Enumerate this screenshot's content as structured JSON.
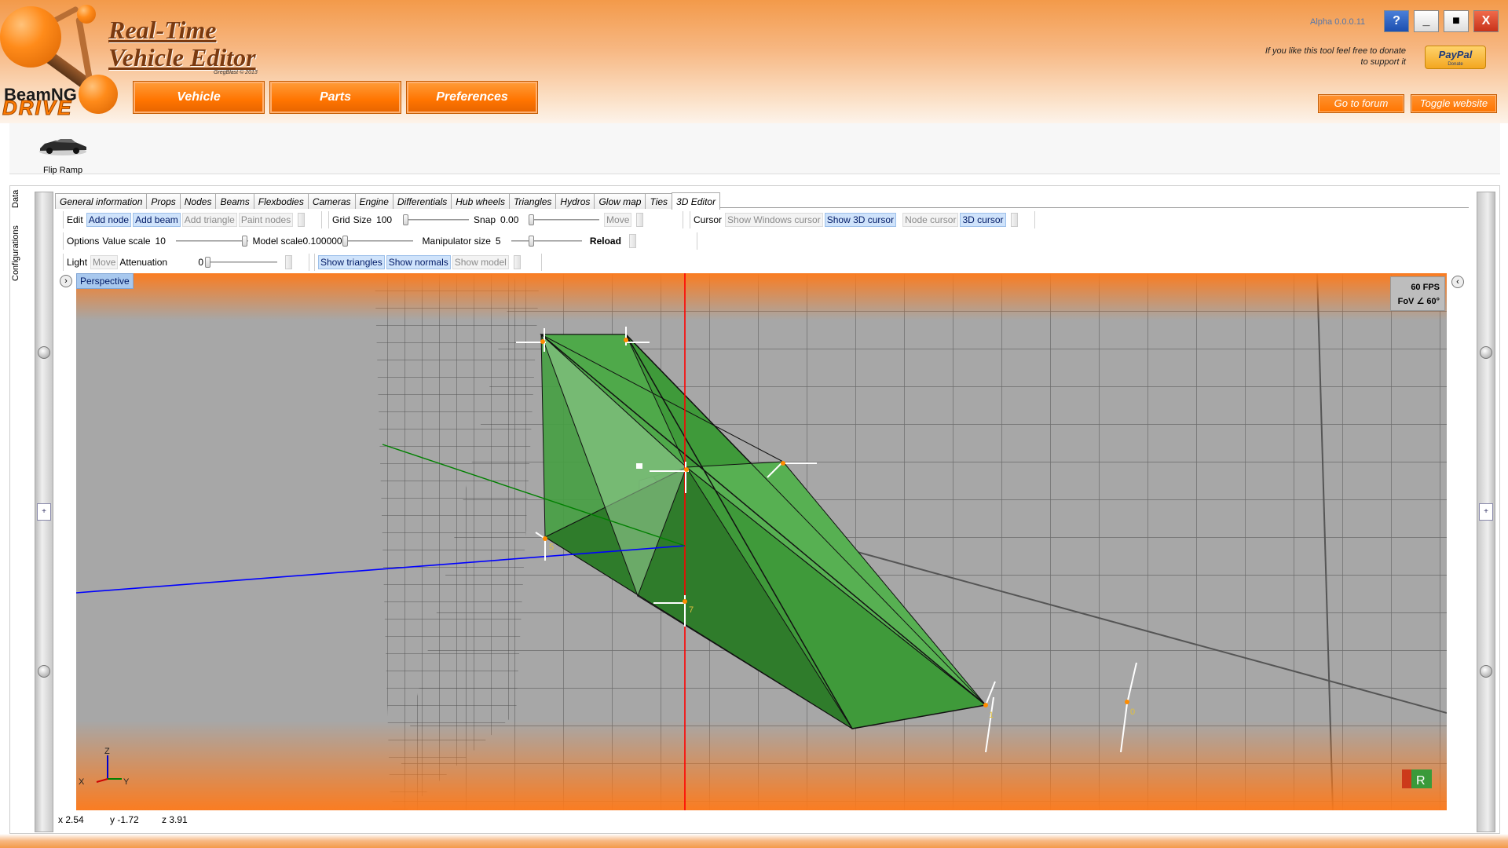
{
  "app": {
    "title_line1": "Real-Time",
    "title_line2": "Vehicle Editor",
    "credit": "GregBlast © 2013",
    "brand": "BeamNG",
    "brand_sub": "DRIVE",
    "version": "Alpha 0.0.0.11"
  },
  "window_controls": {
    "help": "?",
    "minimize": "_",
    "maximize": "■",
    "close": "X"
  },
  "main_nav": [
    "Vehicle",
    "Parts",
    "Preferences"
  ],
  "donate": {
    "text": "If you like this tool feel free to donate to support it",
    "paypal": "PayPal",
    "paypal_sub": "Donate"
  },
  "links": {
    "forum": "Go to forum",
    "website": "Toggle website"
  },
  "vehicle": {
    "name": "Flip Ramp"
  },
  "side_tabs": [
    "Data",
    "Configurations"
  ],
  "tabs": [
    "General information",
    "Props",
    "Nodes",
    "Beams",
    "Flexbodies",
    "Cameras",
    "Engine",
    "Differentials",
    "Hub wheels",
    "Triangles",
    "Hydros",
    "Glow map",
    "Ties",
    "3D Editor"
  ],
  "active_tab": "3D Editor",
  "toolbar": {
    "edit": {
      "title": "Edit",
      "add_node": "Add node",
      "add_beam": "Add beam",
      "add_triangle": "Add triangle",
      "paint_nodes": "Paint nodes"
    },
    "grid": {
      "title": "Grid",
      "size_label": "Size",
      "size_value": "100",
      "snap_label": "Snap",
      "snap_value": "0.00",
      "move": "Move"
    },
    "cursor": {
      "title": "Cursor",
      "show_windows": "Show Windows cursor",
      "show_3d": "Show 3D cursor",
      "node_cursor": "Node cursor",
      "cursor_3d": "3D cursor"
    },
    "options": {
      "title": "Options",
      "value_scale_label": "Value scale",
      "value_scale": "10",
      "model_scale_label": "Model scale",
      "model_scale": "0.100000",
      "manip_label": "Manipulator size",
      "manip_value": "5",
      "reload": "Reload"
    },
    "light": {
      "title": "Light",
      "move": "Move",
      "attenuation_label": "Attenuation",
      "attenuation_value": "0"
    },
    "show": {
      "triangles": "Show triangles",
      "normals": "Show normals",
      "model": "Show model"
    }
  },
  "viewport": {
    "view_name": "Perspective",
    "fps": "60 FPS",
    "fov": "FoV ∠ 60°",
    "axis_labels": {
      "x": "X",
      "y": "Y",
      "z": "Z"
    },
    "node_labels": [
      "5",
      "7",
      "1",
      "0"
    ],
    "bg_color": "#a7a7a7",
    "mesh_color": "#3f9a3a",
    "x_axis_color": "#0000ff",
    "y_axis_color": "#008000",
    "z_axis_color": "#ff0000"
  },
  "status": {
    "x": "x 2.54",
    "y": "y -1.72",
    "z": "z 3.91"
  }
}
